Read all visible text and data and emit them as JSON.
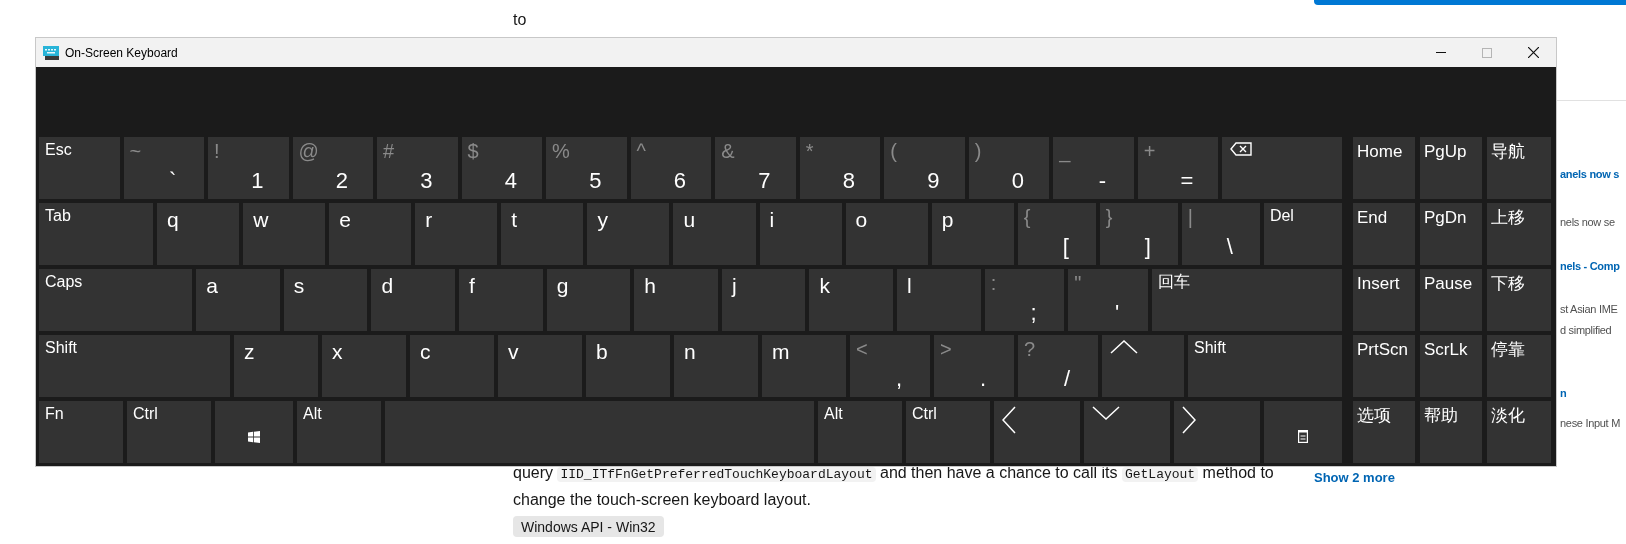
{
  "page": {
    "intro_fragment": "to",
    "paragraph": [
      {
        "kind": "text",
        "text": "query "
      },
      {
        "kind": "code",
        "text": "IID_ITfFnGetPreferredTouchKeyboardLayout"
      },
      {
        "kind": "text",
        "text": " and then have a chance to call its "
      },
      {
        "kind": "code",
        "text": "GetLayout"
      },
      {
        "kind": "text",
        "text": " method to change the touch-screen keyboard layout."
      }
    ],
    "tag": "Windows API - Win32",
    "sidebar": [
      {
        "kind": "link",
        "text": "anels now s"
      },
      {
        "kind": "text",
        "text": "nels now se"
      },
      {
        "kind": "link",
        "text": "nels - Comp"
      },
      {
        "kind": "text",
        "text": "st Asian IME"
      },
      {
        "kind": "text",
        "text": "d simplified"
      },
      {
        "kind": "link",
        "text": "n"
      },
      {
        "kind": "text",
        "text": "nese Input M"
      }
    ],
    "show_more": "Show 2 more"
  },
  "window": {
    "title": "On-Screen Keyboard"
  },
  "keyboard": {
    "key_rows": [
      {
        "keys": [
          {
            "kind": "label",
            "label": "Esc"
          },
          {
            "kind": "symbol",
            "shift": "~",
            "label": "`"
          },
          {
            "kind": "symbol",
            "shift": "!",
            "label": "1"
          },
          {
            "kind": "symbol",
            "shift": "@",
            "label": "2"
          },
          {
            "kind": "symbol",
            "shift": "#",
            "label": "3"
          },
          {
            "kind": "symbol",
            "shift": "$",
            "label": "4"
          },
          {
            "kind": "symbol",
            "shift": "%",
            "label": "5"
          },
          {
            "kind": "symbol",
            "shift": "^",
            "label": "6"
          },
          {
            "kind": "symbol",
            "shift": "&",
            "label": "7"
          },
          {
            "kind": "symbol",
            "shift": "*",
            "label": "8"
          },
          {
            "kind": "symbol",
            "shift": "(",
            "label": "9"
          },
          {
            "kind": "symbol",
            "shift": ")",
            "label": "0"
          },
          {
            "kind": "symbol",
            "shift": "_",
            "label": "-"
          },
          {
            "kind": "symbol",
            "shift": "+",
            "label": "="
          },
          {
            "kind": "backspace"
          }
        ]
      },
      {
        "keys": [
          {
            "kind": "label",
            "label": "Tab"
          },
          {
            "kind": "letter",
            "label": "q"
          },
          {
            "kind": "letter",
            "label": "w"
          },
          {
            "kind": "letter",
            "label": "e"
          },
          {
            "kind": "letter",
            "label": "r"
          },
          {
            "kind": "letter",
            "label": "t"
          },
          {
            "kind": "letter",
            "label": "y"
          },
          {
            "kind": "letter",
            "label": "u"
          },
          {
            "kind": "letter",
            "label": "i"
          },
          {
            "kind": "letter",
            "label": "o"
          },
          {
            "kind": "letter",
            "label": "p"
          },
          {
            "kind": "symbol",
            "shift": "{",
            "label": "["
          },
          {
            "kind": "symbol",
            "shift": "}",
            "label": "]"
          },
          {
            "kind": "symbol",
            "shift": "|",
            "label": "\\"
          },
          {
            "kind": "label",
            "label": "Del"
          }
        ]
      },
      {
        "keys": [
          {
            "kind": "label",
            "label": "Caps"
          },
          {
            "kind": "letter",
            "label": "a"
          },
          {
            "kind": "letter",
            "label": "s"
          },
          {
            "kind": "letter",
            "label": "d"
          },
          {
            "kind": "letter",
            "label": "f"
          },
          {
            "kind": "letter",
            "label": "g"
          },
          {
            "kind": "letter",
            "label": "h"
          },
          {
            "kind": "letter",
            "label": "j"
          },
          {
            "kind": "letter",
            "label": "k"
          },
          {
            "kind": "letter",
            "label": "l"
          },
          {
            "kind": "symbol",
            "shift": ":",
            "label": ";"
          },
          {
            "kind": "symbol",
            "shift": "\"",
            "label": "'"
          },
          {
            "kind": "label",
            "label": "回车"
          }
        ]
      },
      {
        "keys": [
          {
            "kind": "label",
            "label": "Shift"
          },
          {
            "kind": "letter",
            "label": "z"
          },
          {
            "kind": "letter",
            "label": "x"
          },
          {
            "kind": "letter",
            "label": "c"
          },
          {
            "kind": "letter",
            "label": "v"
          },
          {
            "kind": "letter",
            "label": "b"
          },
          {
            "kind": "letter",
            "label": "n"
          },
          {
            "kind": "letter",
            "label": "m"
          },
          {
            "kind": "symbol",
            "shift": "<",
            "label": ","
          },
          {
            "kind": "symbol",
            "shift": ">",
            "label": "."
          },
          {
            "kind": "symbol",
            "shift": "?",
            "label": "/"
          },
          {
            "kind": "arrow-up"
          },
          {
            "kind": "label",
            "label": "Shift"
          }
        ]
      },
      {
        "keys": [
          {
            "kind": "label",
            "label": "Fn"
          },
          {
            "kind": "label",
            "label": "Ctrl"
          },
          {
            "kind": "windows"
          },
          {
            "kind": "label",
            "label": "Alt"
          },
          {
            "kind": "space"
          },
          {
            "kind": "label",
            "label": "Alt"
          },
          {
            "kind": "label",
            "label": "Ctrl"
          },
          {
            "kind": "arrow-left"
          },
          {
            "kind": "arrow-down"
          },
          {
            "kind": "arrow-right"
          },
          {
            "kind": "menu"
          }
        ]
      }
    ],
    "side_keys": [
      "Home",
      "PgUp",
      "导航",
      "End",
      "PgDn",
      "上移",
      "Insert",
      "Pause",
      "下移",
      "PrtScn",
      "ScrLk",
      "停靠",
      "选项",
      "帮助",
      "淡化"
    ]
  }
}
